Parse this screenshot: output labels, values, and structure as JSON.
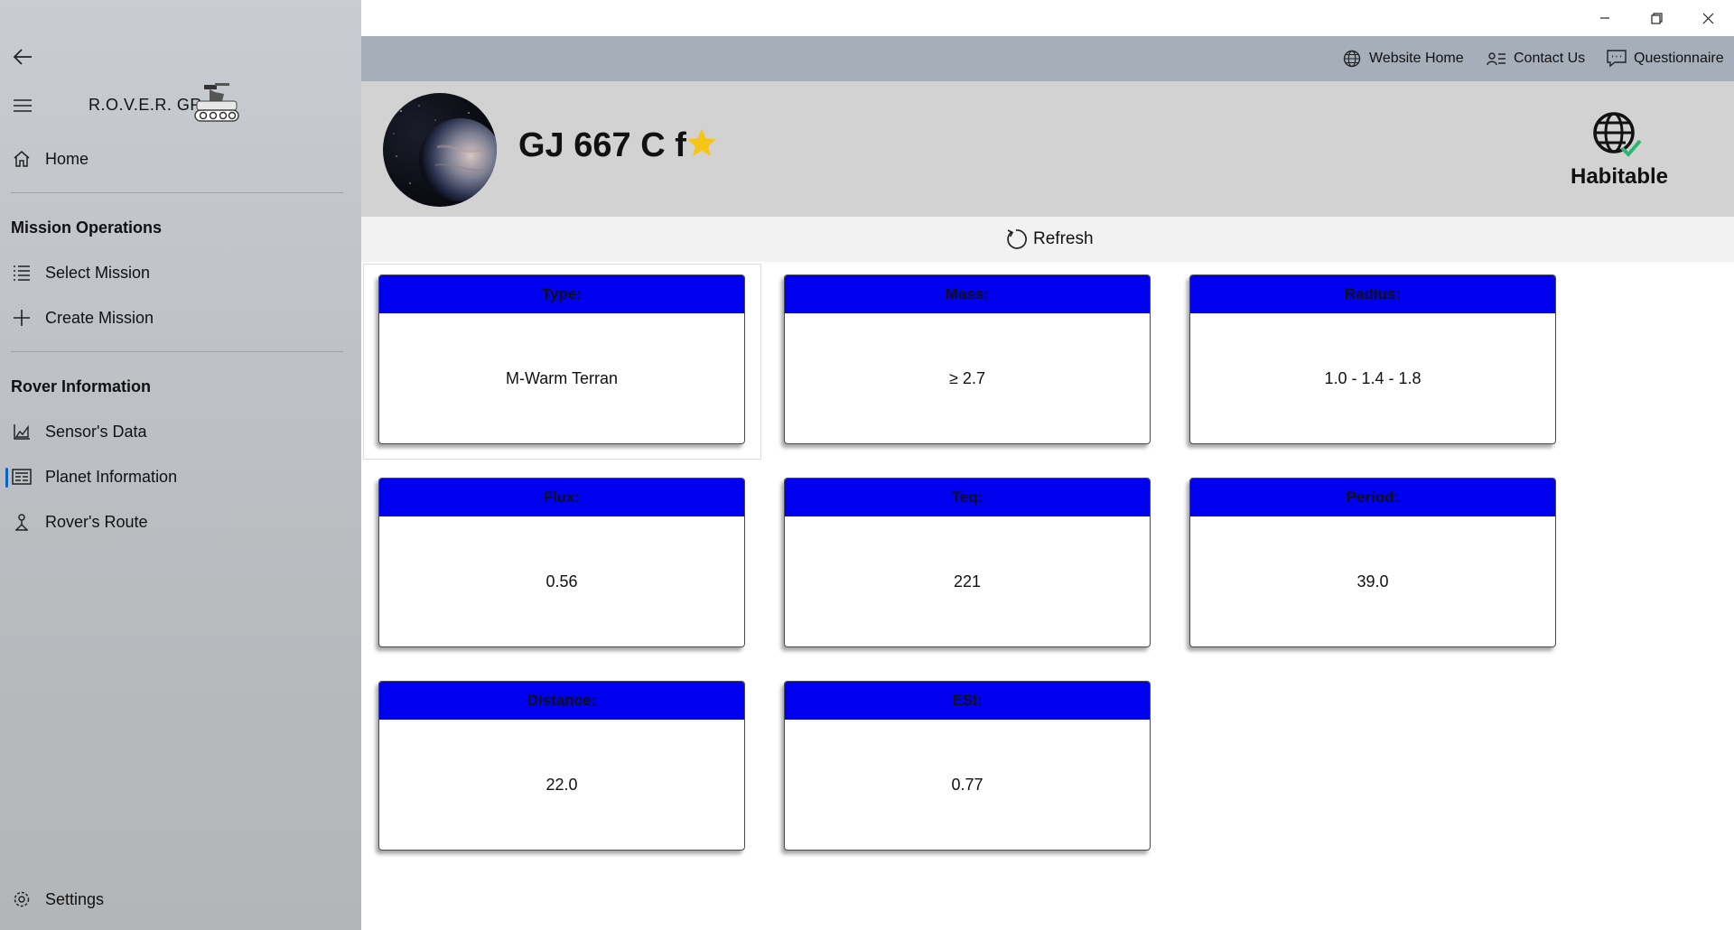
{
  "app": {
    "title": "R.O.V.E.R. GR"
  },
  "sidebar": {
    "home_label": "Home",
    "sections": [
      {
        "title": "Mission Operations",
        "items": [
          {
            "label": "Select Mission"
          },
          {
            "label": "Create Mission"
          }
        ]
      },
      {
        "title": "Rover Information",
        "items": [
          {
            "label": "Sensor's Data"
          },
          {
            "label": "Planet Information"
          },
          {
            "label": "Rover's Route"
          }
        ]
      }
    ],
    "settings_label": "Settings",
    "active_item": "Planet Information"
  },
  "commandbar": {
    "website_home": "Website Home",
    "contact_us": "Contact Us",
    "questionnaire": "Questionnaire"
  },
  "planet": {
    "name": "GJ 667 C f",
    "favorite": true,
    "habitable_label": "Habitable"
  },
  "refresh_label": "Refresh",
  "cards": [
    {
      "label": "Type:",
      "value": "M-Warm Terran"
    },
    {
      "label": "Mass:",
      "value": "≥ 2.7"
    },
    {
      "label": "Radius:",
      "value": "1.0 - 1.4 - 1.8"
    },
    {
      "label": "Flux:",
      "value": "0.56"
    },
    {
      "label": "Teq:",
      "value": "221"
    },
    {
      "label": "Period:",
      "value": "39.0"
    },
    {
      "label": "Distance:",
      "value": "22.0"
    },
    {
      "label": "ESI:",
      "value": "0.77"
    }
  ],
  "colors": {
    "card_header": "#0000f0",
    "commandbar": "#a5aeb9",
    "header": "#d2d2d2",
    "star": "#f5c518",
    "check": "#2bb673"
  }
}
